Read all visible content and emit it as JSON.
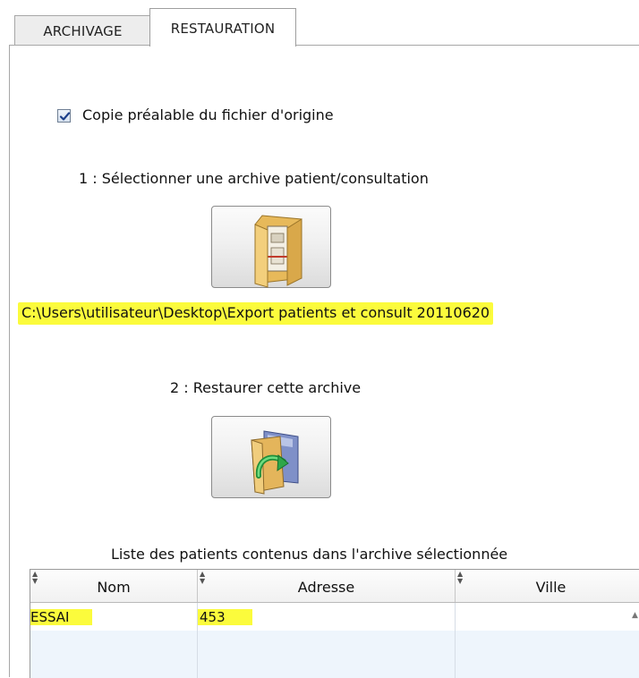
{
  "tabs": [
    {
      "label": "ARCHIVAGE",
      "active": false
    },
    {
      "label": "RESTAURATION",
      "active": true
    }
  ],
  "options": {
    "copy_original_label": "Copie préalable du fichier d'origine",
    "copy_original_checked": true
  },
  "step1": {
    "label": "1 : Sélectionner une archive patient/consultation",
    "button_icon": "folder-open-icon",
    "selected_path": "C:\\Users\\utilisateur\\Desktop\\Export patients et consult 20110620"
  },
  "step2": {
    "label": "2 : Restaurer cette archive",
    "button_icon": "folder-restore-icon"
  },
  "patients": {
    "title": "Liste des patients contenus dans l'archive sélectionnée",
    "columns": [
      "Nom",
      "Adresse",
      "Ville"
    ],
    "rows": [
      {
        "nom": "ESSAI",
        "adresse": "453",
        "ville": ""
      }
    ]
  },
  "colors": {
    "highlight": "#fbfb3c",
    "row_alt": "#eef5fc"
  }
}
